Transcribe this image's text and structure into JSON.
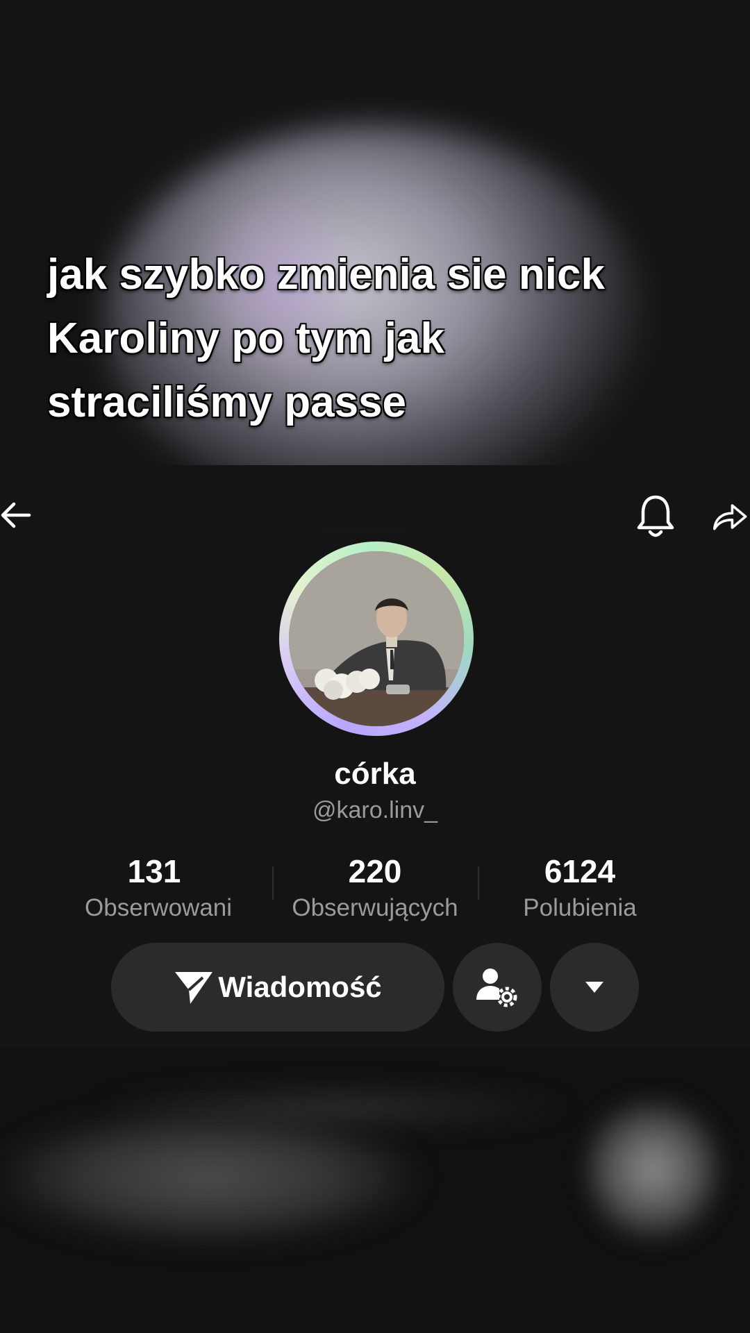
{
  "caption": {
    "lines": [
      "jak szybko zmienia sie nick",
      "Karoliny po tym jak",
      "straciliśmy passe"
    ]
  },
  "header": {
    "back_icon": "arrow-left-icon",
    "bell_icon": "bell-icon",
    "share_icon": "share-arrow-icon"
  },
  "profile": {
    "display_name": "córka",
    "username": "@karo.linv_",
    "avatar_ring_colors": [
      "#b9a6ff",
      "#e4f2d0",
      "#b7f0c8",
      "#9fd9c2"
    ]
  },
  "stats": [
    {
      "value": "131",
      "label": "Obserwowani"
    },
    {
      "value": "220",
      "label": "Obserwujących"
    },
    {
      "value": "6124",
      "label": "Polubienia"
    }
  ],
  "actions": {
    "message_label": "Wiadomość",
    "message_icon": "send-icon",
    "friend_settings_icon": "user-settings-icon",
    "more_icon": "caret-down-icon"
  },
  "colors": {
    "background": "#141414",
    "button_bg": "#2b2b2b",
    "secondary_text": "#9b9b9b"
  }
}
